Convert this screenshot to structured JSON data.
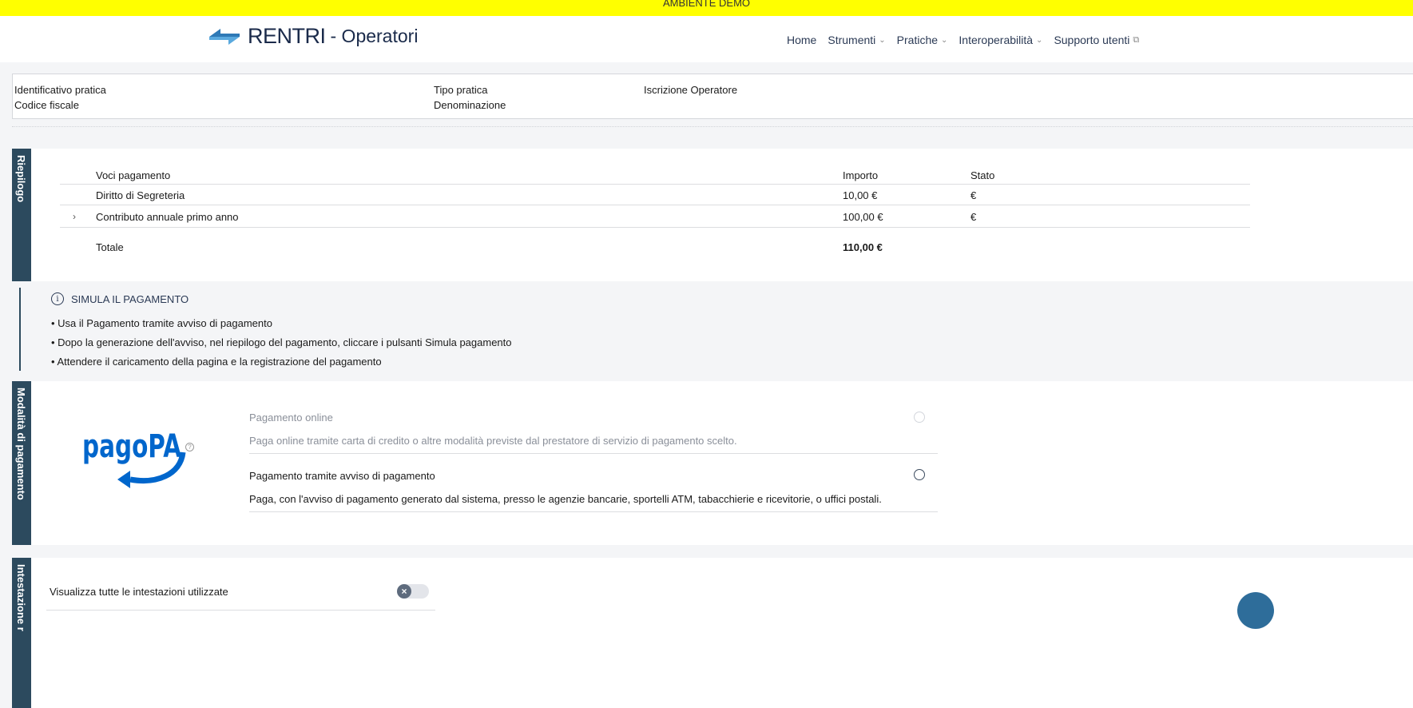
{
  "env_banner": "AMBIENTE DEMO",
  "header": {
    "brand": "RENTRI",
    "subtitle": "- Operatori",
    "nav": [
      {
        "label": "Home",
        "has_dropdown": false
      },
      {
        "label": "Strumenti",
        "has_dropdown": true
      },
      {
        "label": "Pratiche",
        "has_dropdown": true
      },
      {
        "label": "Interoperabilità",
        "has_dropdown": true
      },
      {
        "label": "Supporto utenti",
        "external": true
      }
    ]
  },
  "practice_info": {
    "id_label": "Identificativo pratica",
    "cf_label": "Codice fiscale",
    "type_label": "Tipo pratica",
    "type_value": "Iscrizione Operatore",
    "denomination_label": "Denominazione"
  },
  "summary": {
    "tab_label": "Riepilogo",
    "columns": [
      "Voci pagamento",
      "Importo",
      "Stato"
    ],
    "rows": [
      {
        "item": "Diritto di Segreteria",
        "amount": "10,00 €",
        "status": "€",
        "expandable": false
      },
      {
        "item": "Contributo annuale primo anno",
        "amount": "100,00 €",
        "status": "€",
        "expandable": true
      }
    ],
    "total_label": "Totale",
    "total_value": "110,00 €"
  },
  "notice": {
    "title": "SIMULA IL PAGAMENTO",
    "bullets": [
      "Usa il Pagamento tramite avviso di pagamento",
      "Dopo la generazione dell'avviso, nel riepilogo del pagamento, cliccare i pulsanti Simula pagamento",
      "Attendere il caricamento della pagina e la registrazione del pagamento"
    ]
  },
  "payment": {
    "tab_label": "Modalità di pagamento",
    "logo_text": "pagoPA",
    "options": [
      {
        "title": "Pagamento online",
        "description": "Paga online tramite carta di credito o altre modalità previste dal prestatore di servizio di pagamento scelto.",
        "disabled": true
      },
      {
        "title": "Pagamento tramite avviso di pagamento",
        "description": "Paga, con l'avviso di pagamento generato dal sistema, presso le agenzie bancarie, sportelli ATM, tabacchierie e ricevitorie, o uffici postali.",
        "disabled": false
      }
    ]
  },
  "headers_section": {
    "tab_label": "Intestazione r",
    "toggle_label": "Visualizza tutte le intestazioni utilizzate",
    "toggle_on": false
  },
  "colors": {
    "banner": "#ffff00",
    "sidebar_tab": "#2c4a5e",
    "pagopa_blue": "#0066cc"
  },
  "icons": [
    "arrows-logo-icon",
    "chevron-down-icon",
    "external-link-icon",
    "info-icon",
    "chevron-right-icon",
    "help-icon",
    "radio-icon",
    "toggle-off-icon"
  ]
}
